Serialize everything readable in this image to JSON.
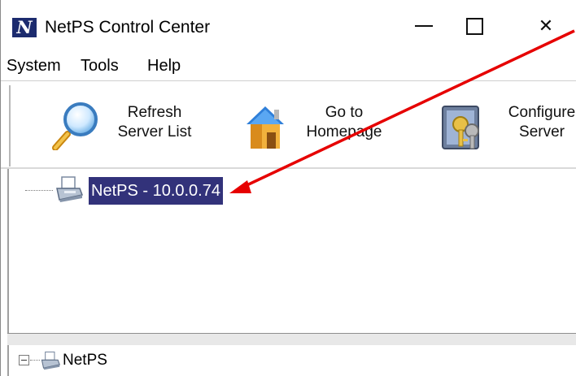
{
  "window": {
    "title": "NetPS Control Center",
    "logo_letter": "N",
    "controls": {
      "minimize": "minimize",
      "maximize": "maximize",
      "close": "✕"
    }
  },
  "menu": {
    "items": [
      "System",
      "Tools",
      "Help"
    ]
  },
  "toolbar": {
    "buttons": [
      {
        "line1": "Refresh",
        "line2": "Server List",
        "icon": "magnifier-icon"
      },
      {
        "line1": "Go to",
        "line2": "Homepage",
        "icon": "house-icon"
      },
      {
        "line1": "Configure",
        "line2": "Server",
        "icon": "configure-keys-icon"
      }
    ]
  },
  "server_tree": {
    "items": [
      {
        "label": "NetPS - 10.0.0.74",
        "selected": true,
        "icon": "printer-icon"
      }
    ]
  },
  "lower_tree": {
    "root": {
      "label": "NetPS",
      "expanded": true,
      "icon": "printer-icon"
    }
  },
  "colors": {
    "selection": "#32327a",
    "annotation_arrow": "#e60000",
    "logo_bg": "#1c2b6e"
  }
}
